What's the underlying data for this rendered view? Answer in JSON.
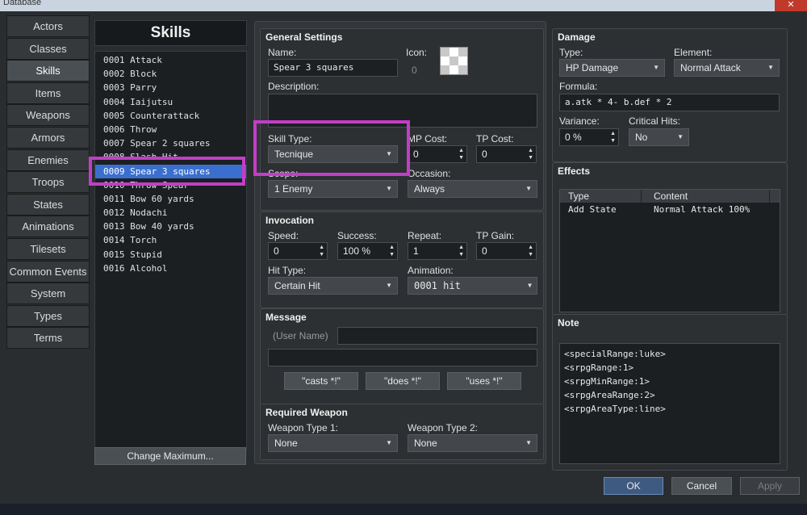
{
  "window": {
    "title": "Database",
    "close": "✕"
  },
  "categories": [
    "Actors",
    "Classes",
    "Skills",
    "Items",
    "Weapons",
    "Armors",
    "Enemies",
    "Troops",
    "States",
    "Animations",
    "Tilesets",
    "Common Events",
    "System",
    "Types",
    "Terms"
  ],
  "selected_category": "Skills",
  "skills": {
    "header": "Skills",
    "items": [
      "0001 Attack",
      "0002 Block",
      "0003 Parry",
      "0004 Iaijutsu",
      "0005 Counterattack",
      "0006 Throw",
      "0007 Spear 2 squares",
      "0008 Slash Hit",
      "0009 Spear 3 squares",
      "0010 Throw Spear",
      "0011 Bow 60 yards",
      "0012 Nodachi",
      "0013 Bow 40 yards",
      "0014 Torch",
      "0015 Stupid",
      "0016 Alcohol"
    ],
    "selected_index": 8,
    "change_max": "Change Maximum..."
  },
  "general": {
    "title": "General Settings",
    "name_label": "Name:",
    "name_value": "Spear 3 squares",
    "icon_label": "Icon:",
    "icon_value": "0",
    "desc_label": "Description:",
    "desc_value": "",
    "skilltype_label": "Skill Type:",
    "skilltype_value": "Tecnique",
    "mpcost_label": "MP Cost:",
    "mpcost_value": "0",
    "tpcost_label": "TP Cost:",
    "tpcost_value": "0",
    "scope_label": "Scope:",
    "scope_value": "1 Enemy",
    "occasion_label": "Occasion:",
    "occasion_value": "Always"
  },
  "invocation": {
    "title": "Invocation",
    "speed_label": "Speed:",
    "speed_value": "0",
    "success_label": "Success:",
    "success_value": "100 %",
    "repeat_label": "Repeat:",
    "repeat_value": "1",
    "tpgain_label": "TP Gain:",
    "tpgain_value": "0",
    "hittype_label": "Hit Type:",
    "hittype_value": "Certain Hit",
    "animation_label": "Animation:",
    "animation_value": "0001 hit"
  },
  "message": {
    "title": "Message",
    "username_label": "(User Name)",
    "line1": "",
    "line2": "",
    "btn_casts": "\"casts *!\"",
    "btn_does": "\"does *!\"",
    "btn_uses": "\"uses *!\""
  },
  "weapon": {
    "title": "Required Weapon",
    "type1_label": "Weapon Type 1:",
    "type1_value": "None",
    "type2_label": "Weapon Type 2:",
    "type2_value": "None"
  },
  "damage": {
    "title": "Damage",
    "type_label": "Type:",
    "type_value": "HP Damage",
    "element_label": "Element:",
    "element_value": "Normal Attack",
    "formula_label": "Formula:",
    "formula_value": "a.atk * 4- b.def * 2",
    "variance_label": "Variance:",
    "variance_value": "0 %",
    "critical_label": "Critical Hits:",
    "critical_value": "No"
  },
  "effects": {
    "title": "Effects",
    "col_type": "Type",
    "col_content": "Content",
    "rows": [
      {
        "type": "Add State",
        "content": "Normal Attack 100%"
      }
    ]
  },
  "note": {
    "title": "Note",
    "lines": [
      "<specialRange:luke>",
      "<srpgRange:1>",
      "<srpgMinRange:1>",
      "<srpgAreaRange:2>",
      "<srpgAreaType:line>"
    ]
  },
  "dialog": {
    "ok": "OK",
    "cancel": "Cancel",
    "apply": "Apply"
  },
  "colors": {
    "highlight": "#c23ec7",
    "selection": "#3a6fd0"
  }
}
